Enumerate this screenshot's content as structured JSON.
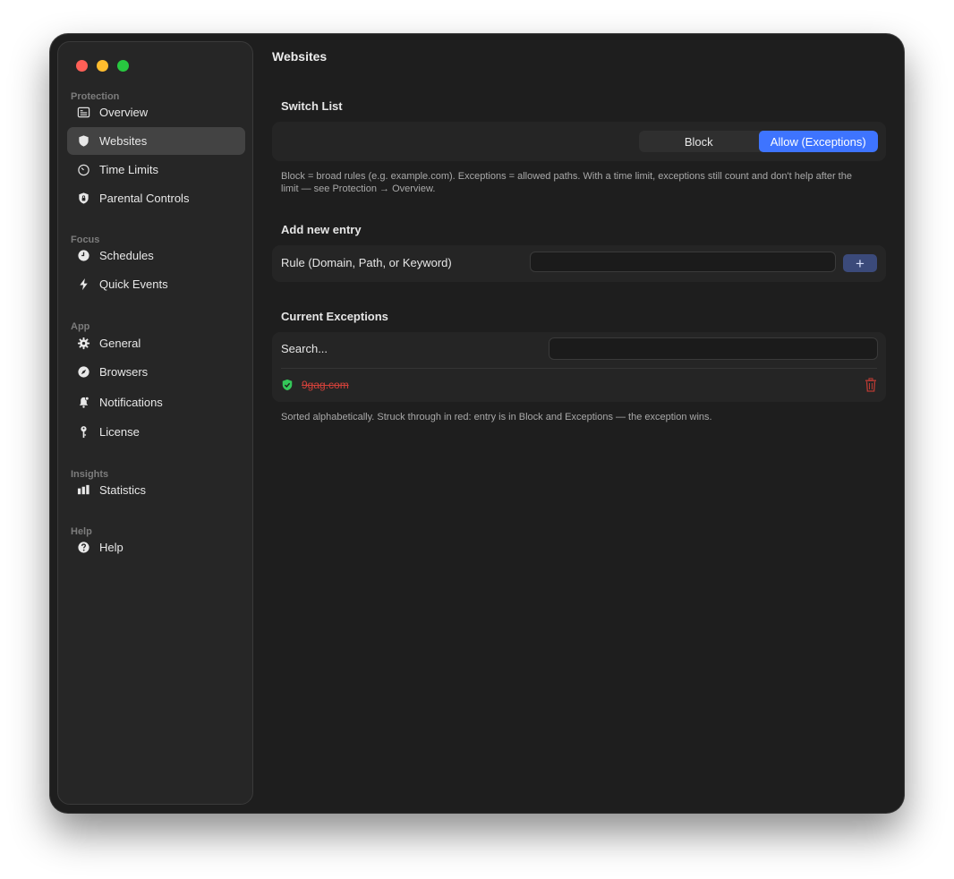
{
  "window": {
    "title": "Websites"
  },
  "sidebar": {
    "sections": [
      {
        "heading": "Protection",
        "items": [
          {
            "label": "Overview",
            "icon": "overview-icon"
          },
          {
            "label": "Websites",
            "icon": "shield-icon",
            "active": true
          },
          {
            "label": "Time Limits",
            "icon": "timer-icon"
          },
          {
            "label": "Parental Controls",
            "icon": "lock-shield-icon"
          }
        ]
      },
      {
        "heading": "Focus",
        "items": [
          {
            "label": "Schedules",
            "icon": "clock-icon"
          },
          {
            "label": "Quick Events",
            "icon": "bolt-icon"
          }
        ]
      },
      {
        "heading": "App",
        "items": [
          {
            "label": "General",
            "icon": "gear-icon"
          },
          {
            "label": "Browsers",
            "icon": "compass-icon"
          },
          {
            "label": "Notifications",
            "icon": "bell-icon"
          },
          {
            "label": "License",
            "icon": "key-icon"
          }
        ]
      },
      {
        "heading": "Insights",
        "items": [
          {
            "label": "Statistics",
            "icon": "bar-chart-icon"
          }
        ]
      },
      {
        "heading": "Help",
        "items": [
          {
            "label": "Help",
            "icon": "question-icon"
          }
        ]
      }
    ]
  },
  "switch_list": {
    "heading": "Switch List",
    "options": [
      "Block",
      "Allow (Exceptions)"
    ],
    "selected": "Allow (Exceptions)",
    "note": "Block = broad rules (e.g. example.com). Exceptions = allowed paths. With a time limit, exceptions still count and don't help after the limit — see Protection → Overview."
  },
  "add_entry": {
    "heading": "Add new entry",
    "label": "Rule (Domain, Path, or Keyword)",
    "value": "",
    "add_label": "+"
  },
  "exceptions": {
    "heading": "Current Exceptions",
    "search_label": "Search...",
    "search_value": "",
    "entries": [
      {
        "domain": "9gag.com",
        "conflict": true,
        "status_color": "#34c759"
      }
    ],
    "note": "Sorted alphabetically. Struck through in red: entry is in Block and Exceptions — the exception wins."
  },
  "colors": {
    "accent": "#3e74ff",
    "conflict": "#d3413a",
    "ok": "#34c759"
  }
}
